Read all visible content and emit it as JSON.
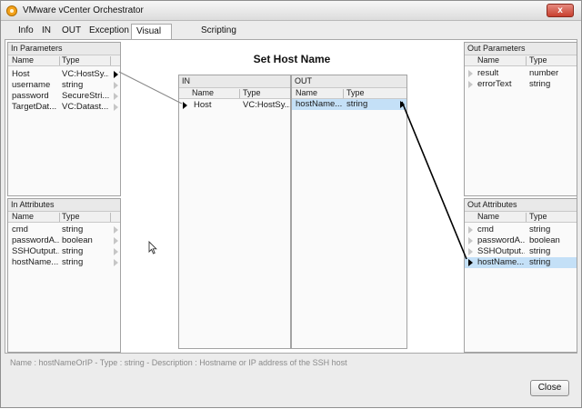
{
  "window": {
    "title": "VMware vCenter Orchestrator",
    "close_glyph": "x"
  },
  "tabs": [
    {
      "label": "Info"
    },
    {
      "label": "IN"
    },
    {
      "label": "OUT"
    },
    {
      "label": "Exception"
    },
    {
      "label": "Visual Binding",
      "active": true
    },
    {
      "label": "Scripting"
    }
  ],
  "in_parameters": {
    "title": "In Parameters",
    "col_name": "Name",
    "col_type": "Type",
    "rows": [
      {
        "name": "Host",
        "type": "VC:HostSy...",
        "bound": true
      },
      {
        "name": "username",
        "type": "string"
      },
      {
        "name": "password",
        "type": "SecureStri..."
      },
      {
        "name": "TargetDat...",
        "type": "VC:Datast..."
      }
    ]
  },
  "in_attributes": {
    "title": "In Attributes",
    "col_name": "Name",
    "col_type": "Type",
    "rows": [
      {
        "name": "cmd",
        "type": "string"
      },
      {
        "name": "passwordA...",
        "type": "boolean"
      },
      {
        "name": "SSHOutput...",
        "type": "string"
      },
      {
        "name": "hostName...",
        "type": "string"
      }
    ]
  },
  "workflow_element": {
    "title": "Set Host Name",
    "in_box": {
      "title": "IN",
      "col_name": "Name",
      "col_type": "Type",
      "rows": [
        {
          "name": "Host",
          "type": "VC:HostSy..."
        }
      ]
    },
    "out_box": {
      "title": "OUT",
      "col_name": "Name",
      "col_type": "Type",
      "rows": [
        {
          "name": "hostName...",
          "type": "string",
          "selected": true
        }
      ]
    }
  },
  "out_parameters": {
    "title": "Out Parameters",
    "col_name": "Name",
    "col_type": "Type",
    "rows": [
      {
        "name": "result",
        "type": "number"
      },
      {
        "name": "errorText",
        "type": "string"
      }
    ]
  },
  "out_attributes": {
    "title": "Out Attributes",
    "col_name": "Name",
    "col_type": "Type",
    "rows": [
      {
        "name": "cmd",
        "type": "string"
      },
      {
        "name": "passwordA...",
        "type": "boolean"
      },
      {
        "name": "SSHOutput...",
        "type": "string"
      },
      {
        "name": "hostName...",
        "type": "string",
        "selected": true
      }
    ]
  },
  "status": {
    "text": "Name : hostNameOrIP - Type : string - Description : Hostname or IP address of the SSH host"
  },
  "buttons": {
    "close_label": "Close"
  },
  "colors": {
    "selection": "#c4e0f7",
    "panel_bg": "#fafafa",
    "window_bg": "#ececec"
  },
  "icons": {
    "app": "vco-app-icon",
    "cursor": "mouse-pointer-icon"
  }
}
